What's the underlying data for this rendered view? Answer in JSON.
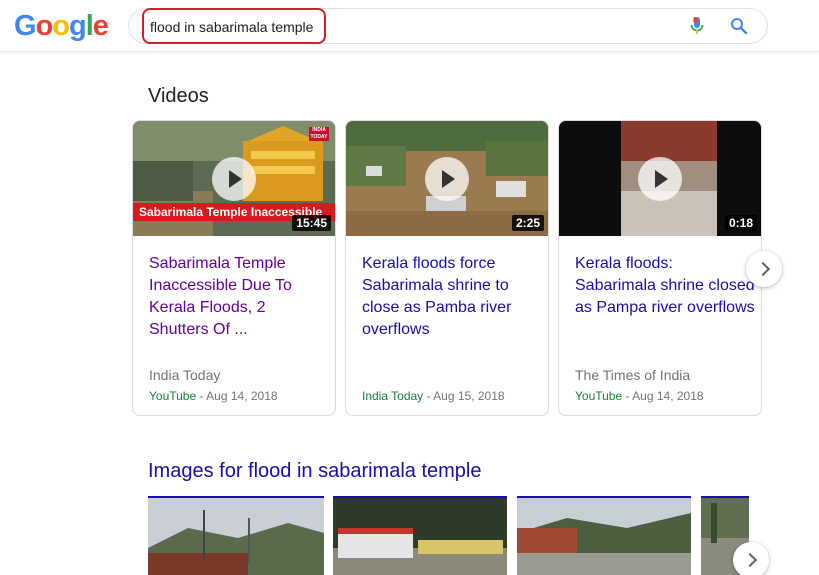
{
  "header": {
    "logo_letters": [
      "G",
      "o",
      "o",
      "g",
      "l",
      "e"
    ],
    "logo_colors": [
      "#4285f4",
      "#ea4335",
      "#fbbc05",
      "#4285f4",
      "#34a853",
      "#ea4335"
    ],
    "search_query": "flood in sabarimala temple",
    "mic_icon": "mic-icon",
    "search_icon": "search-icon"
  },
  "videos": {
    "title": "Videos",
    "items": [
      {
        "title": "Sabarimala Temple Inaccessible Due To Kerala Floods, 2 Shutters Of ...",
        "source": "India Today",
        "platform": "YouTube",
        "date": " - Aug 14, 2018",
        "duration": "15:45",
        "banner": "Sabarimala Temple Inaccessible",
        "badge": "INDIA TODAY",
        "visited": true
      },
      {
        "title": "Kerala floods force Sabarimala shrine to close as Pamba river overflows",
        "source": "",
        "platform": "India Today",
        "date": " - Aug 15, 2018",
        "duration": "2:25",
        "visited": false
      },
      {
        "title": "Kerala floods: Sabarimala shrine closed as Pampa river overflows",
        "source": "The Times of India",
        "platform": "YouTube",
        "date": " - Aug 14, 2018",
        "duration": "0:18",
        "visited": false
      }
    ]
  },
  "images": {
    "title": "Images for flood in sabarimala temple"
  },
  "colors": {
    "link": "#1a0dab",
    "visited": "#660099",
    "highlight": "#d0202a",
    "platform": "#188038"
  }
}
